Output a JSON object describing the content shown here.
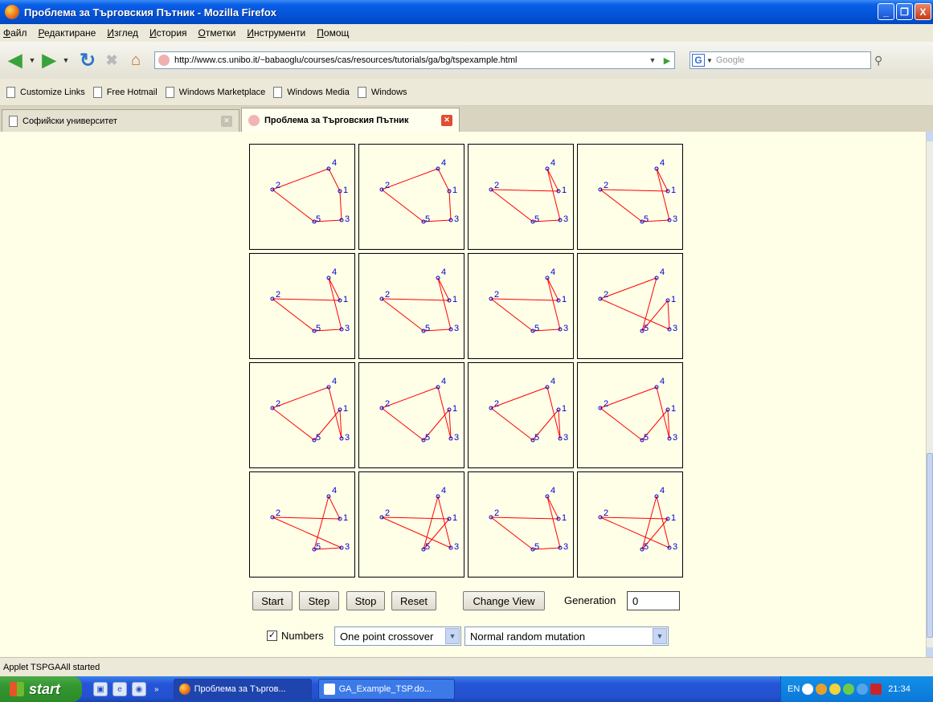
{
  "window": {
    "title": "Проблема за Търговския Пътник - Mozilla Firefox",
    "controls": [
      "_",
      "❐",
      "X"
    ]
  },
  "menu": [
    "Файл",
    "Редактиране",
    "Изглед",
    "История",
    "Отметки",
    "Инструменти",
    "Помощ"
  ],
  "navbar": {
    "url": "http://www.cs.unibo.it/~babaoglu/courses/cas/resources/tutorials/ga/bg/tspexample.html",
    "search_placeholder": "Google",
    "search_engine_icon": "G"
  },
  "bookmarks": [
    "Customize Links",
    "Free Hotmail",
    "Windows Marketplace",
    "Windows Media",
    "Windows"
  ],
  "tabs": [
    {
      "label": "Софийски университет",
      "active": false
    },
    {
      "label": "Проблема за Търговския Пътник",
      "active": true
    }
  ],
  "applet": {
    "city_labels": [
      "1",
      "2",
      "3",
      "4",
      "5"
    ],
    "tours": [
      [
        2,
        4,
        1,
        3,
        5
      ],
      [
        2,
        4,
        1,
        3,
        5
      ],
      [
        2,
        1,
        4,
        3,
        5
      ],
      [
        2,
        1,
        4,
        3,
        5
      ],
      [
        2,
        1,
        4,
        3,
        5
      ],
      [
        2,
        1,
        4,
        3,
        5
      ],
      [
        2,
        1,
        4,
        3,
        5
      ],
      [
        2,
        4,
        5,
        1,
        3
      ],
      [
        2,
        4,
        3,
        1,
        5
      ],
      [
        2,
        4,
        3,
        1,
        5
      ],
      [
        2,
        4,
        3,
        1,
        5
      ],
      [
        2,
        4,
        3,
        1,
        5
      ],
      [
        2,
        1,
        4,
        5,
        3
      ],
      [
        2,
        3,
        4,
        5,
        1
      ],
      [
        2,
        1,
        4,
        3,
        5
      ],
      [
        2,
        1,
        5,
        4,
        3
      ]
    ],
    "buttons": {
      "start": "Start",
      "step": "Step",
      "stop": "Stop",
      "reset": "Reset",
      "change_view": "Change View"
    },
    "generation_label": "Generation",
    "generation_value": "0",
    "numbers_label": "Numbers",
    "numbers_checked": true,
    "crossover_selected": "One point crossover",
    "mutation_selected": "Normal random mutation",
    "edge_color": "#ff0000",
    "node_color": "#0000cc"
  },
  "status": "Applet TSPGAAll started",
  "taskbar": {
    "start_label": "start",
    "items": [
      "Проблема за Търгов...",
      "GA_Example_TSP.do..."
    ],
    "language": "EN",
    "clock": "21:34"
  }
}
